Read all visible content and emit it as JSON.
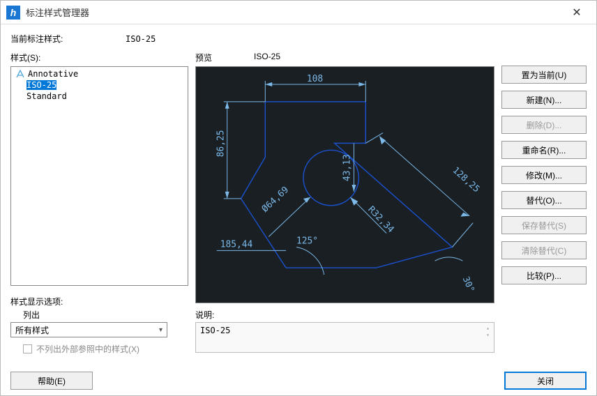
{
  "window": {
    "title": "标注样式管理器",
    "close": "✕"
  },
  "current": {
    "label": "当前标注样式:",
    "value": "ISO-25"
  },
  "styles": {
    "label": "样式(S):",
    "items": [
      {
        "name": "Annotative",
        "icon": true,
        "selected": false
      },
      {
        "name": "ISO-25",
        "icon": false,
        "selected": true
      },
      {
        "name": "Standard",
        "icon": false,
        "selected": false
      }
    ]
  },
  "display_options": {
    "header": "样式显示选项:",
    "sub": "列出",
    "select_value": "所有样式",
    "checkbox_label": "不列出外部参照中的样式(X)",
    "checked": false
  },
  "preview": {
    "label": "预览",
    "style_name": "ISO-25",
    "dimensions": {
      "top": "108",
      "left": "86,25",
      "radius_inner": "43,13",
      "diameter": "Ø64,69",
      "radius_outer": "R32,34",
      "angle": "125°",
      "bottom": "185,44",
      "right": "128,25",
      "right_angle": "30°"
    }
  },
  "description": {
    "label": "说明:",
    "value": "ISO-25"
  },
  "buttons": {
    "set_current": "置为当前(U)",
    "new": "新建(N)...",
    "delete": "删除(D)...",
    "rename": "重命名(R)...",
    "modify": "修改(M)...",
    "override": "替代(O)...",
    "save_override": "保存替代(S)",
    "clear_override": "清除替代(C)",
    "compare": "比较(P)...",
    "help": "帮助(E)",
    "close": "关闭"
  }
}
